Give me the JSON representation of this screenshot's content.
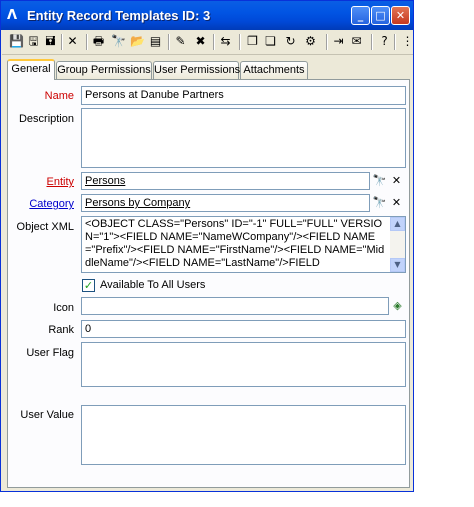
{
  "window": {
    "logo": "Λ",
    "title": "Entity Record Templates ID: 3",
    "controls": {
      "minimize": "_",
      "maximize": "□",
      "close": "✕"
    }
  },
  "toolbar": {
    "icons": [
      "save-icon",
      "save-new-icon",
      "save-close-icon",
      "delete-icon",
      "print-icon",
      "find-icon",
      "open-folder-icon",
      "report-icon",
      "new-record-icon",
      "delete-record-icon",
      "link-icon",
      "copy-icon",
      "paste-icon",
      "refresh-icon",
      "settings-icon",
      "attach-icon",
      "note-icon",
      "help-icon",
      "more-icon"
    ],
    "glyphs": [
      "💾",
      "🖫",
      "🖬",
      "✕",
      "🖶",
      "🔭",
      "📂",
      "▤",
      "✎",
      "✖",
      "⇆",
      "❐",
      "❏",
      "↻",
      "⚙",
      "⇥",
      "✉",
      "?",
      "⋮"
    ]
  },
  "tabs": [
    "General",
    "Group Permissions",
    "User Permissions",
    "Attachments"
  ],
  "form": {
    "name_label": "Name",
    "name_value": "Persons at Danube Partners",
    "description_label": "Description",
    "description_value": "",
    "entity_label": "Entity",
    "entity_value": "Persons",
    "category_label": "Category",
    "category_value": "Persons by Company",
    "object_xml_label": "Object XML",
    "object_xml_value": "<OBJECT CLASS=\"Persons\" ID=\"-1\" FULL=\"FULL\" VERSION=\"1\"><FIELD NAME=\"NameWCompany\"/><FIELD NAME=\"Prefix\"/><FIELD NAME=\"FirstName\"/><FIELD NAME=\"MiddleName\"/><FIELD NAME=\"LastName\"/>FIELD",
    "available_label": "Available To All Users",
    "available_checked": "✓",
    "icon_label": "Icon",
    "icon_value": "",
    "rank_label": "Rank",
    "rank_value": "0",
    "user_flag_label": "User Flag",
    "user_flag_value": "",
    "user_value_label": "User Value",
    "user_value_value": ""
  },
  "buttons": {
    "find": "🔭",
    "clear": "✕",
    "scroll_up": "▲",
    "scroll_down": "▼",
    "icon_picker": "◈"
  },
  "colors": {
    "title_bar": "#0154e3",
    "required_label": "#cc0000",
    "link_label": "#0000cc",
    "active_tab_accent": "#ffc83c"
  }
}
